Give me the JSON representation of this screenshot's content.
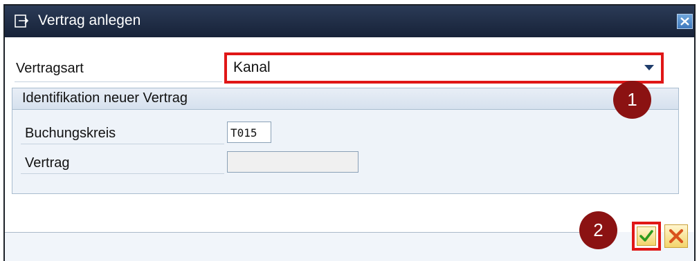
{
  "window": {
    "title": "Vertrag anlegen",
    "title_icon": "create-document-icon",
    "close_icon": "close-icon"
  },
  "form": {
    "contract_type": {
      "label": "Vertragsart",
      "value": "Kanal"
    },
    "group": {
      "title": "Identifikation neuer Vertrag",
      "company_code": {
        "label": "Buchungskreis",
        "value": "T015"
      },
      "contract": {
        "label": "Vertrag",
        "value": ""
      }
    }
  },
  "annotations": {
    "marker_1": "1",
    "marker_2": "2",
    "marker_color": "#8b1212",
    "highlight_color": "#e01717"
  },
  "footer": {
    "confirm_icon": "checkmark-icon",
    "cancel_icon": "cancel-x-icon"
  }
}
